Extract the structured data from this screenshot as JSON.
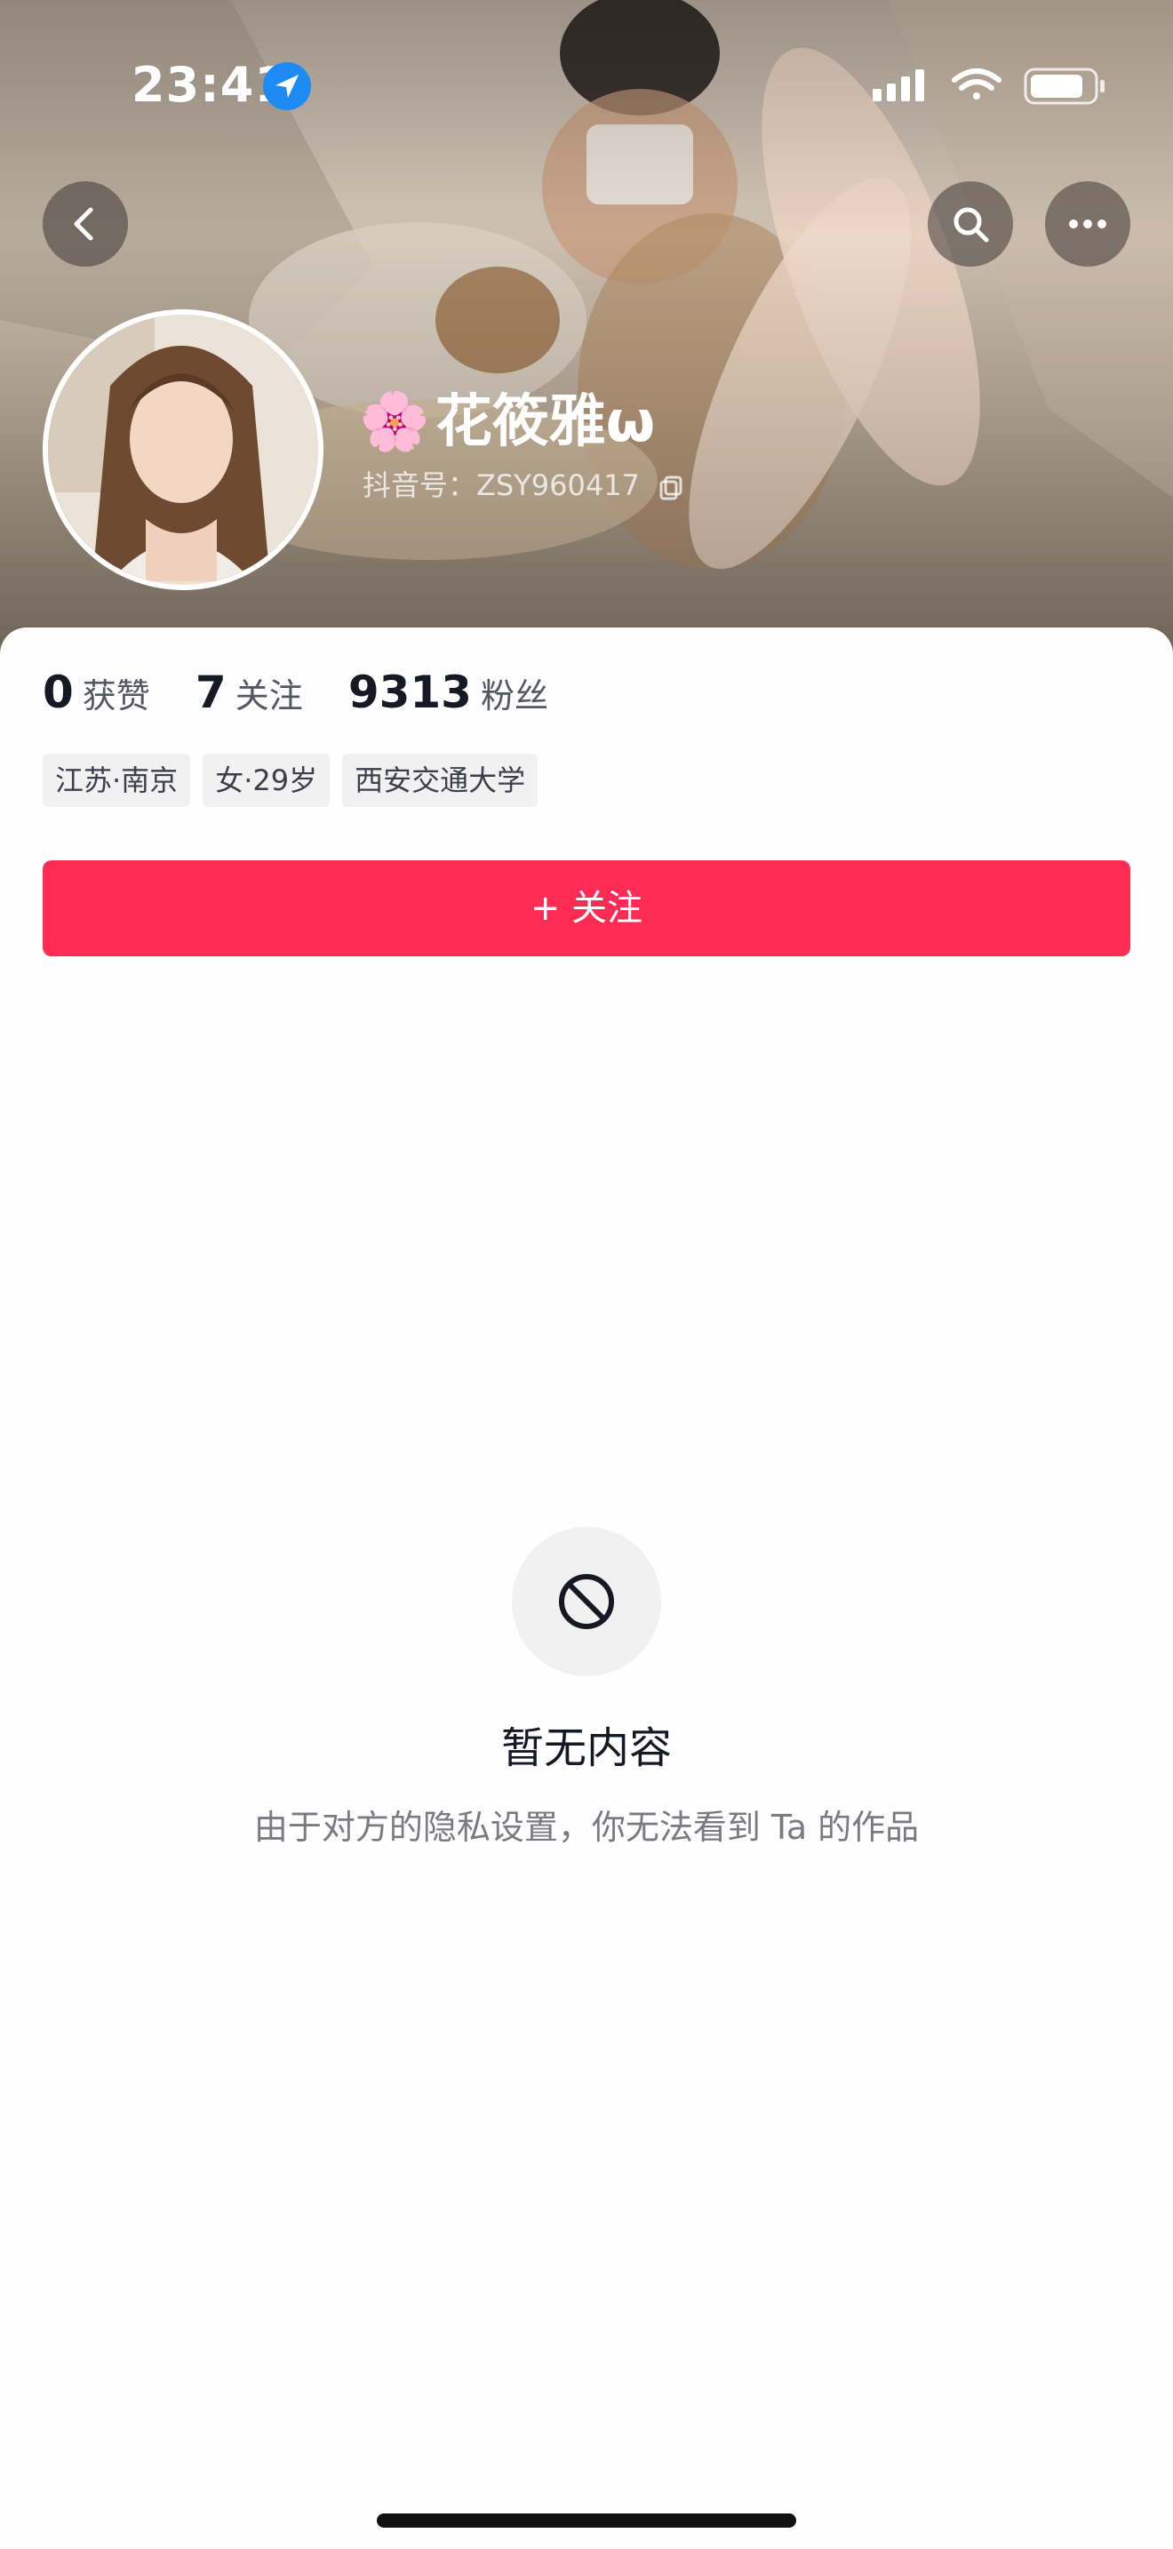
{
  "status_bar": {
    "time": "23:41",
    "icons": [
      "location-arrow-icon",
      "signal-icon",
      "wifi-icon",
      "battery-icon"
    ]
  },
  "nav": {
    "icons": [
      "back-icon",
      "search-icon",
      "more-icon"
    ]
  },
  "profile": {
    "flower": "🌸",
    "name": "花筱雅ω",
    "douyin_id": "抖音号：ZSY960417",
    "stats": [
      {
        "value": "0",
        "label": "获赞"
      },
      {
        "value": "7",
        "label": "关注"
      },
      {
        "value": "9313",
        "label": "粉丝"
      }
    ],
    "tags": [
      "江苏·南京",
      "女·29岁",
      "西安交通大学"
    ]
  },
  "follow_button": {
    "label": "+ 关注"
  },
  "empty_state": {
    "icon": "blocked-icon",
    "title": "暂无内容",
    "description": "由于对方的隐私设置，你无法看到 Ta 的作品"
  },
  "colors": {
    "accent": "#fe2c55",
    "status_location": "#1e8bf5",
    "text_primary": "#161823",
    "text_secondary": "#7a7b82",
    "tag_bg": "#f1f1f2"
  }
}
